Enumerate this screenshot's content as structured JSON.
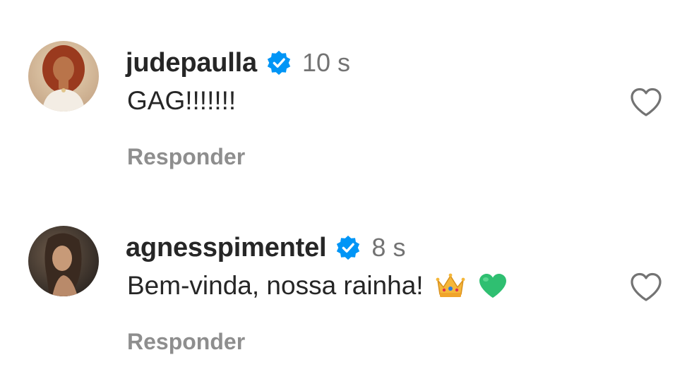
{
  "comments": [
    {
      "username": "judepaulla",
      "verified": true,
      "time": "10 s",
      "text": "GAG!!!!!!!",
      "reply_label": "Responder",
      "avatar": "avatar-photo"
    },
    {
      "username": "agnesspimentel",
      "verified": true,
      "time": "8 s",
      "text": "Bem-vinda, nossa rainha!",
      "emojis": [
        "crown-icon",
        "green-heart-icon"
      ],
      "reply_label": "Responder",
      "avatar": "avatar-photo"
    }
  ],
  "colors": {
    "verified_badge": "#0095f6",
    "secondary_text": "#737373",
    "reply_text": "#8e8e8e",
    "primary_text": "#262626"
  },
  "icons": {
    "like": "heart-outline-icon",
    "verified": "verified-badge-icon"
  }
}
